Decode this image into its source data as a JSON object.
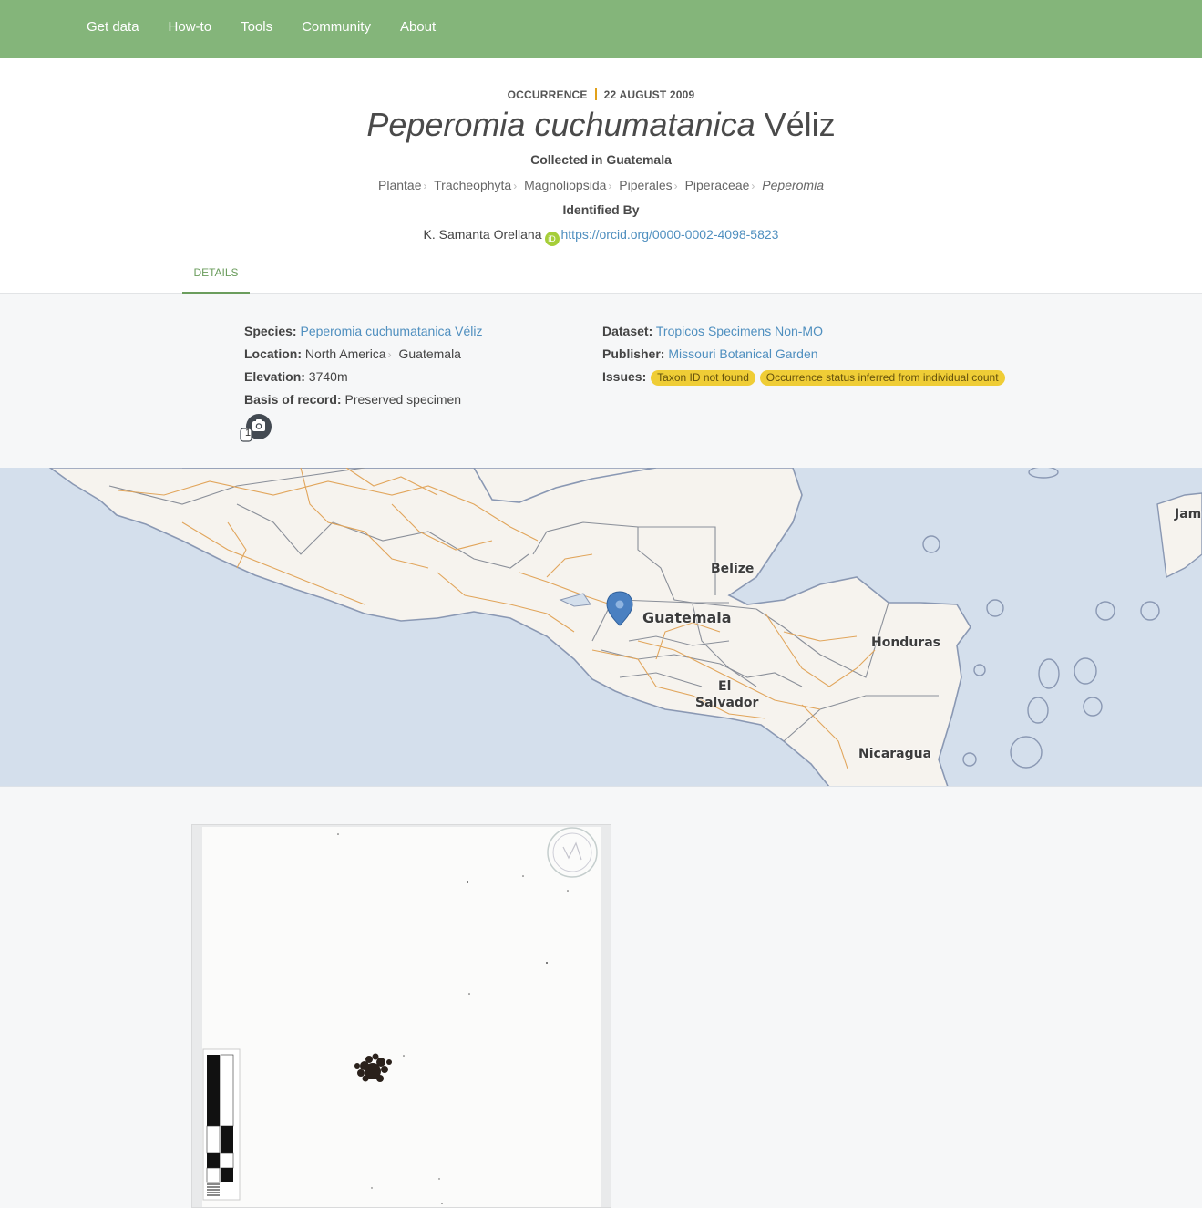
{
  "nav": {
    "items": [
      "Get data",
      "How-to",
      "Tools",
      "Community",
      "About"
    ]
  },
  "header": {
    "kicker_type": "OCCURRENCE",
    "kicker_date": "22 AUGUST 2009",
    "title_scientific": "Peperomia cuchumatanica",
    "title_author": "Véliz",
    "collected": "Collected in Guatemala",
    "taxonomy": [
      "Plantae",
      "Tracheophyta",
      "Magnoliopsida",
      "Piperales",
      "Piperaceae",
      "Peperomia"
    ],
    "identified_heading": "Identified By",
    "identifier_name": "K. Samanta Orellana",
    "orcid_icon": "iD",
    "identifier_url": "https://orcid.org/0000-0002-4098-5823",
    "tab_label": "DETAILS"
  },
  "details": {
    "species_label": "Species:",
    "species_value": "Peperomia cuchumatanica Véliz",
    "location_label": "Location:",
    "location_continent": "North America",
    "location_country": "Guatemala",
    "elevation_label": "Elevation:",
    "elevation_value": "3740m",
    "basis_label": "Basis of record:",
    "basis_value": "Preserved specimen",
    "dataset_label": "Dataset:",
    "dataset_value": "Tropicos Specimens Non-MO",
    "publisher_label": "Publisher:",
    "publisher_value": "Missouri Botanical Garden",
    "issues_label": "Issues:",
    "issues": [
      "Taxon ID not found",
      "Occurrence status inferred from individual count"
    ],
    "media_count": "1",
    "media_icon": "camera-icon"
  },
  "map": {
    "labels": {
      "belize": "Belize",
      "guatemala": "Guatemala",
      "honduras": "Honduras",
      "el_salvador_1": "El",
      "el_salvador_2": "Salvador",
      "nicaragua": "Nicaragua",
      "jamaica_partial": "Jam"
    },
    "marker_icon": "map-pin-icon",
    "colors": {
      "water": "#d4dfec",
      "land": "#f6f3ee",
      "roads": "#e1a55b",
      "borders": "#8a8f99",
      "marker": "#4a80c1"
    }
  },
  "colors": {
    "nav": "#84b57a",
    "accent": "#6b9d5d",
    "link": "#4f8fbf",
    "issue": "#efcd36"
  }
}
